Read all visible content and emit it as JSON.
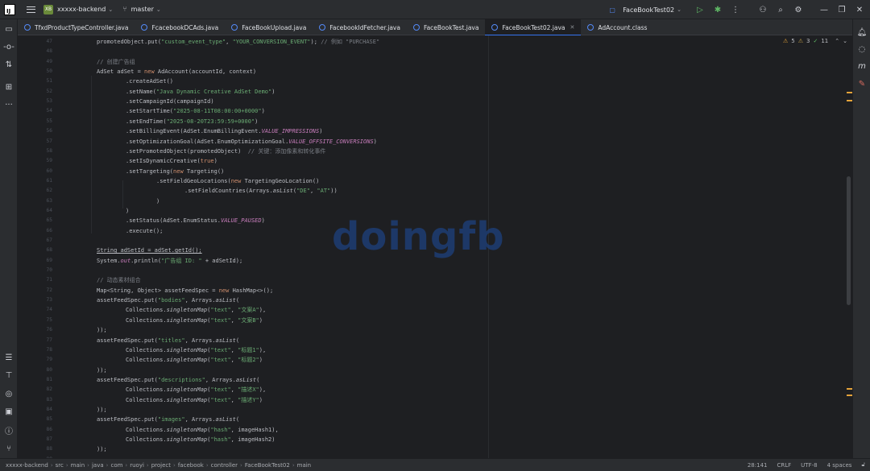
{
  "titlebar": {
    "project_badge": "XB",
    "project_name": "xxxxx-backend",
    "branch": "master",
    "run_config": "FaceBookTest02"
  },
  "tabs": [
    {
      "label": "TfxdProductTypeController.java",
      "active": false
    },
    {
      "label": "FcacebookDCAds.java",
      "active": false
    },
    {
      "label": "FaceBookUpload.java",
      "active": false
    },
    {
      "label": "FacebookIdFetcher.java",
      "active": false
    },
    {
      "label": "FaceBookTest.java",
      "active": false
    },
    {
      "label": "FaceBookTest02.java",
      "active": true
    },
    {
      "label": "AdAccount.class",
      "active": false
    }
  ],
  "inspections": {
    "warnings": "5",
    "weak_warnings": "3",
    "typos": "11"
  },
  "line_numbers": [
    "47",
    "48",
    "49",
    "50",
    "51",
    "52",
    "53",
    "54",
    "55",
    "56",
    "57",
    "58",
    "59",
    "60",
    "61",
    "62",
    "63",
    "64",
    "65",
    "66",
    "67",
    "68",
    "69",
    "70",
    "71",
    "72",
    "73",
    "74",
    "75",
    "76",
    "77",
    "78",
    "79",
    "80",
    "81",
    "82",
    "83",
    "84",
    "85",
    "86",
    "87",
    "88",
    "89"
  ],
  "code_lines": [
    "promotedObject.put(\"custom_event_type\", \"YOUR_CONVERSION_EVENT\"); // 例如 \"PURCHASE\"",
    "",
    "// 创建广告组",
    "AdSet adSet = new AdAccount(accountId, context)",
    ".createAdSet()",
    ".setName(\"Java Dynamic Creative AdSet Demo\")",
    ".setCampaignId(campaignId)",
    ".setStartTime(\"2025-08-11T08:00:00+0000\")",
    ".setEndTime(\"2025-08-20T23:59:59+0000\")",
    ".setBillingEvent(AdSet.EnumBillingEvent.VALUE_IMPRESSIONS)",
    ".setOptimizationGoal(AdSet.EnumOptimizationGoal.VALUE_OFFSITE_CONVERSIONS)",
    ".setPromotedObject(promotedObject)  // 关键：添加像素和转化事件",
    ".setIsDynamicCreative(true)",
    ".setTargeting(new Targeting()",
    ".setFieldGeoLocations(new TargetingGeoLocation()",
    ".setFieldCountries(Arrays.asList(\"DE\", \"AT\"))",
    ")",
    ")",
    ".setStatus(AdSet.EnumStatus.VALUE_PAUSED)",
    ".execute();",
    "",
    "String adSetId = adSet.getId();",
    "System.out.println(\"广告组 ID: \" + adSetId);",
    "",
    "// 动态素材组合",
    "Map<String, Object> assetFeedSpec = new HashMap<>();",
    "assetFeedSpec.put(\"bodies\", Arrays.asList(",
    "Collections.singletonMap(\"text\", \"文案A\"),",
    "Collections.singletonMap(\"text\", \"文案B\")",
    "));",
    "assetFeedSpec.put(\"titles\", Arrays.asList(",
    "Collections.singletonMap(\"text\", \"标题1\"),",
    "Collections.singletonMap(\"text\", \"标题2\")",
    "));",
    "assetFeedSpec.put(\"descriptions\", Arrays.asList(",
    "Collections.singletonMap(\"text\", \"描述X\"),",
    "Collections.singletonMap(\"text\", \"描述Y\")",
    "));",
    "assetFeedSpec.put(\"images\", Arrays.asList(",
    "Collections.singletonMap(\"hash\", imageHash1),",
    "Collections.singletonMap(\"hash\", imageHash2)",
    "));",
    ""
  ],
  "watermark": "doingfb",
  "statusbar": {
    "breadcrumb": [
      "xxxxx-backend",
      "src",
      "main",
      "java",
      "com",
      "ruoyi",
      "project",
      "facebook",
      "controller",
      "FaceBookTest02",
      "main"
    ],
    "position": "28:141",
    "line_sep": "CRLF",
    "encoding": "UTF-8",
    "indent": "4 spaces"
  },
  "icons": {
    "left": [
      "folder-icon",
      "commit-icon",
      "pull-requests-icon",
      "structure-icon",
      "more-icon",
      "database-icon",
      "build-icon",
      "services-icon",
      "terminal-icon",
      "problems-icon",
      "git-icon"
    ],
    "right": [
      "notifications-icon",
      "ai-assistant-icon",
      "maven-icon",
      "bug-icon"
    ]
  },
  "colors": {
    "accent": "#3574f0",
    "keyword": "#cf8e6d",
    "string": "#6aab73",
    "comment": "#7a7e85",
    "constant": "#c77dbb",
    "warning": "#e5a33a"
  }
}
